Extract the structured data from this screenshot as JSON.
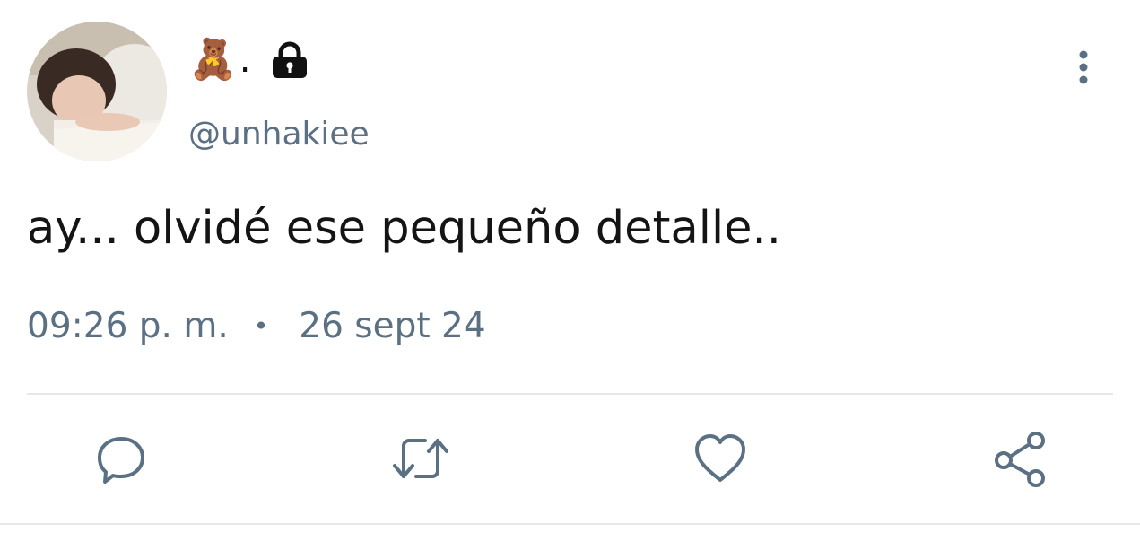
{
  "tweet": {
    "display_name_emoji": "🧸",
    "display_name_suffix": ".",
    "protected_icon": "lock-icon",
    "handle": "@unhakiee",
    "text": "ay... olvidé ese pequeño detalle..",
    "time": "09:26 p. m.",
    "separator": "•",
    "date": "26 sept 24"
  },
  "actions": [
    {
      "icon": "reply-icon"
    },
    {
      "icon": "retweet-icon"
    },
    {
      "icon": "like-icon"
    },
    {
      "icon": "share-icon"
    }
  ],
  "colors": {
    "secondary_text": "#5b7083",
    "primary_text": "#141414",
    "divider": "#e6e8eb"
  }
}
